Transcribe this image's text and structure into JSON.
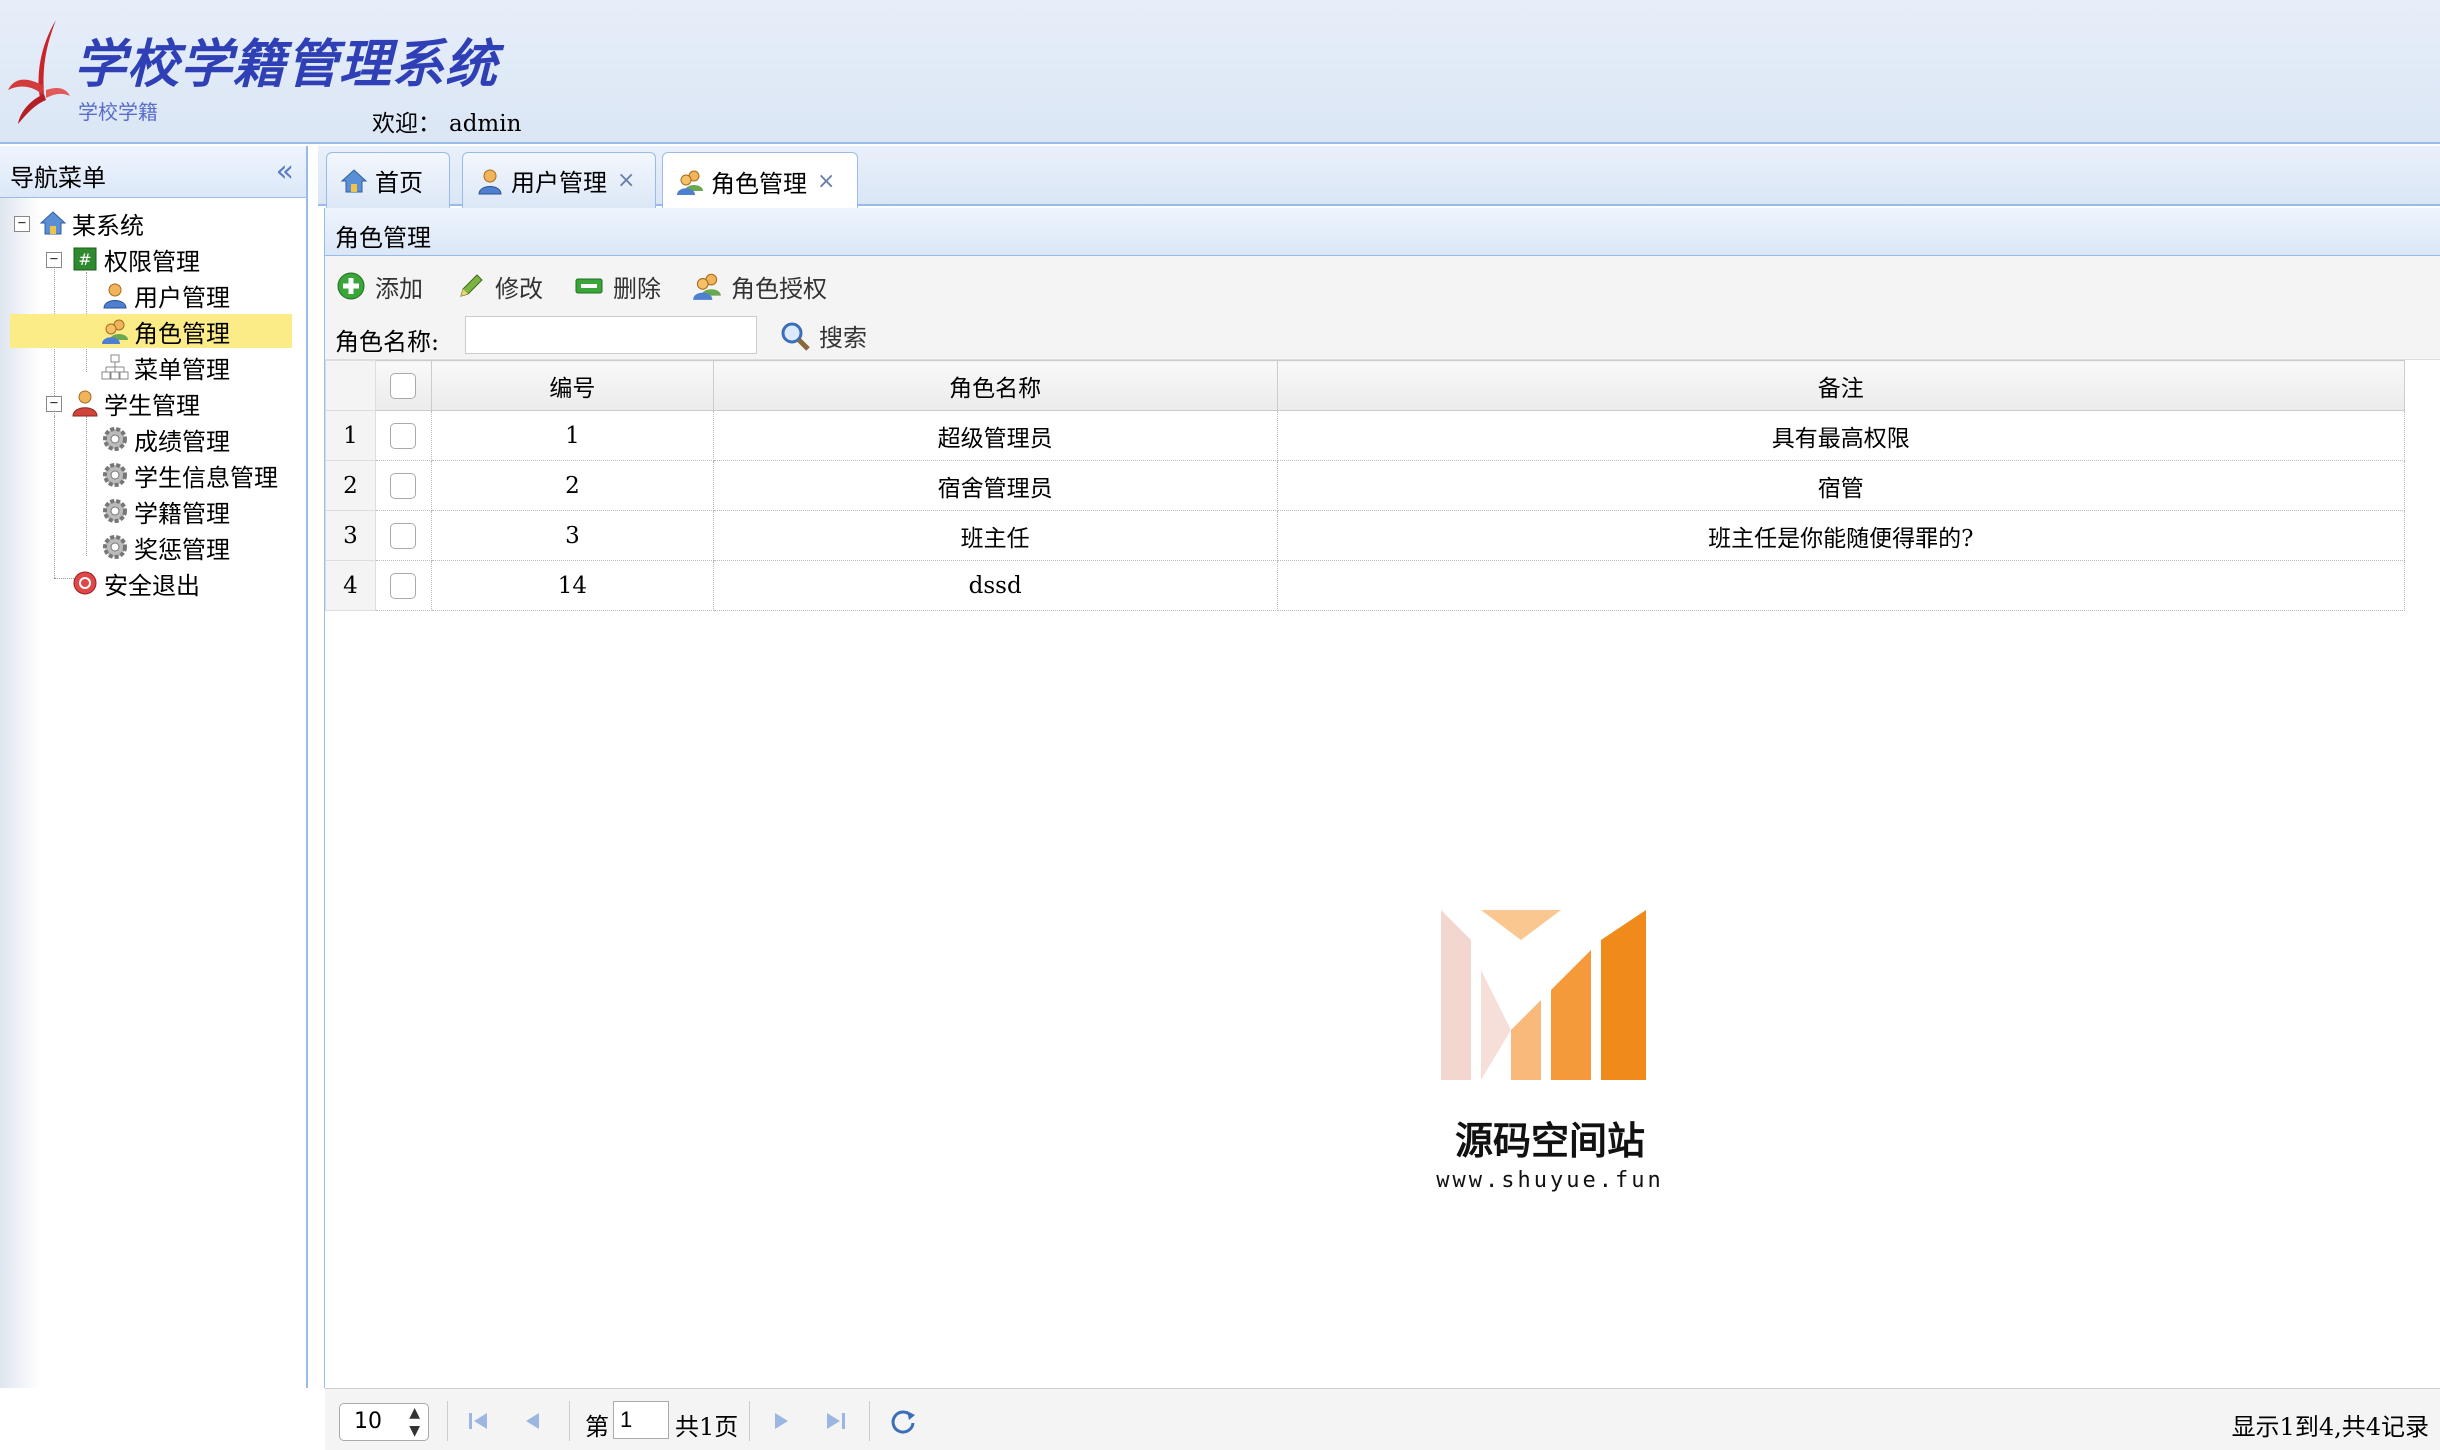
{
  "header": {
    "system_title": "学校学籍管理系统",
    "system_subtitle": "学校学籍",
    "welcome_label": "欢迎：",
    "username": "admin"
  },
  "nav": {
    "title": "导航菜单",
    "collapse_icon": "double-chevron-left-icon",
    "tree": [
      {
        "label": "某系统",
        "icon": "home-icon"
      },
      {
        "label": "权限管理",
        "icon": "grid-icon"
      },
      {
        "label": "用户管理",
        "icon": "user-icon"
      },
      {
        "label": "角色管理",
        "icon": "users-icon",
        "selected": true
      },
      {
        "label": "菜单管理",
        "icon": "sitemap-icon"
      },
      {
        "label": "学生管理",
        "icon": "student-icon"
      },
      {
        "label": "成绩管理",
        "icon": "gear-icon"
      },
      {
        "label": "学生信息管理",
        "icon": "gear-icon"
      },
      {
        "label": "学籍管理",
        "icon": "gear-icon"
      },
      {
        "label": "奖惩管理",
        "icon": "gear-icon"
      },
      {
        "label": "安全退出",
        "icon": "exit-icon"
      }
    ]
  },
  "tabs": [
    {
      "label": "首页",
      "icon": "home-icon",
      "closable": false
    },
    {
      "label": "用户管理",
      "icon": "user-icon",
      "closable": true
    },
    {
      "label": "角色管理",
      "icon": "users-icon",
      "closable": true,
      "active": true
    }
  ],
  "tab_close_glyph": "×",
  "panel": {
    "title": "角色管理",
    "toolbar": {
      "add": "添加",
      "edit": "修改",
      "delete": "删除",
      "authorize": "角色授权"
    },
    "search": {
      "label": "角色名称:",
      "value": "",
      "button": "搜索"
    }
  },
  "grid": {
    "columns": [
      "编号",
      "角色名称",
      "备注"
    ],
    "rows": [
      {
        "rownum": "1",
        "id": "1",
        "name": "超级管理员",
        "remark": "具有最高权限"
      },
      {
        "rownum": "2",
        "id": "2",
        "name": "宿舍管理员",
        "remark": "宿管"
      },
      {
        "rownum": "3",
        "id": "3",
        "name": "班主任",
        "remark": "班主任是你能随便得罪的?"
      },
      {
        "rownum": "4",
        "id": "14",
        "name": "dssd",
        "remark": ""
      }
    ]
  },
  "watermark": {
    "text": "源码空间站",
    "url": "www.shuyue.fun"
  },
  "pager": {
    "page_size": "10",
    "page_label_pre": "第",
    "page_number": "1",
    "page_label_post": "共1页",
    "info": "显示1到4,共4记录"
  },
  "colors": {
    "accent_border": "#99bbe8",
    "selected_row": "#fbec88",
    "logo_title": "#2f3fb6"
  }
}
